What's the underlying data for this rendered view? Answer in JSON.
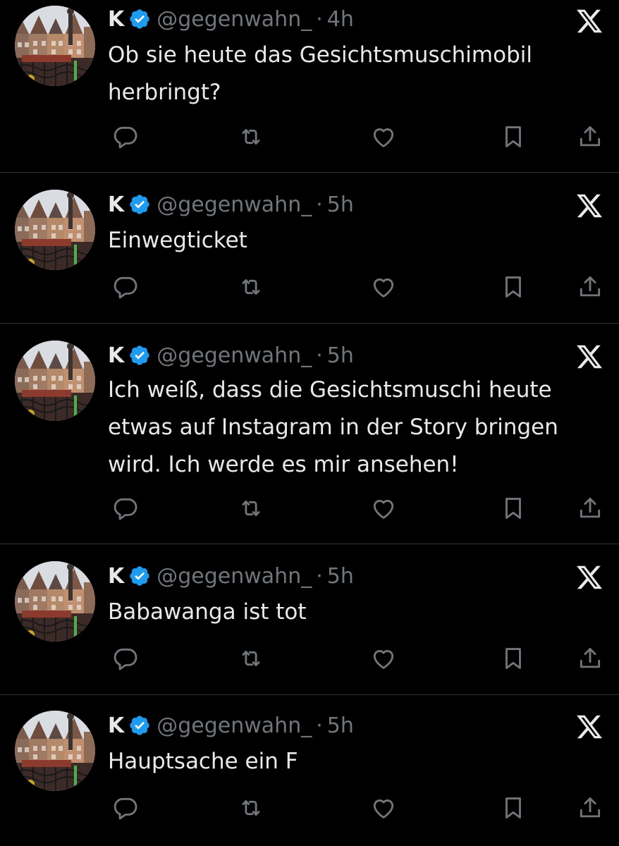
{
  "author": {
    "name": "K",
    "handle": "@gegenwahn_",
    "separator": "·"
  },
  "icons": {
    "verified": "verified-badge-icon",
    "platform": "x-logo-icon",
    "reply": "reply-icon",
    "retweet": "retweet-icon",
    "like": "like-icon",
    "bookmark": "bookmark-icon",
    "share": "share-icon"
  },
  "colors": {
    "background": "#000000",
    "text": "#e7e9ea",
    "secondary": "#71767b",
    "verified": "#1d9bf0"
  },
  "tweets": [
    {
      "time": "4h",
      "text": "Ob sie heute das Gesichtsmuschimobil herbringt?"
    },
    {
      "time": "5h",
      "text": "Einwegticket"
    },
    {
      "time": "5h",
      "text": "Ich weiß, dass die Gesichtsmuschi heute etwas auf Instagram in der Story bringen wird. Ich werde es mir ansehen!"
    },
    {
      "time": "5h",
      "text": "Babawanga ist tot"
    },
    {
      "time": "5h",
      "text": "Hauptsache ein F"
    }
  ]
}
